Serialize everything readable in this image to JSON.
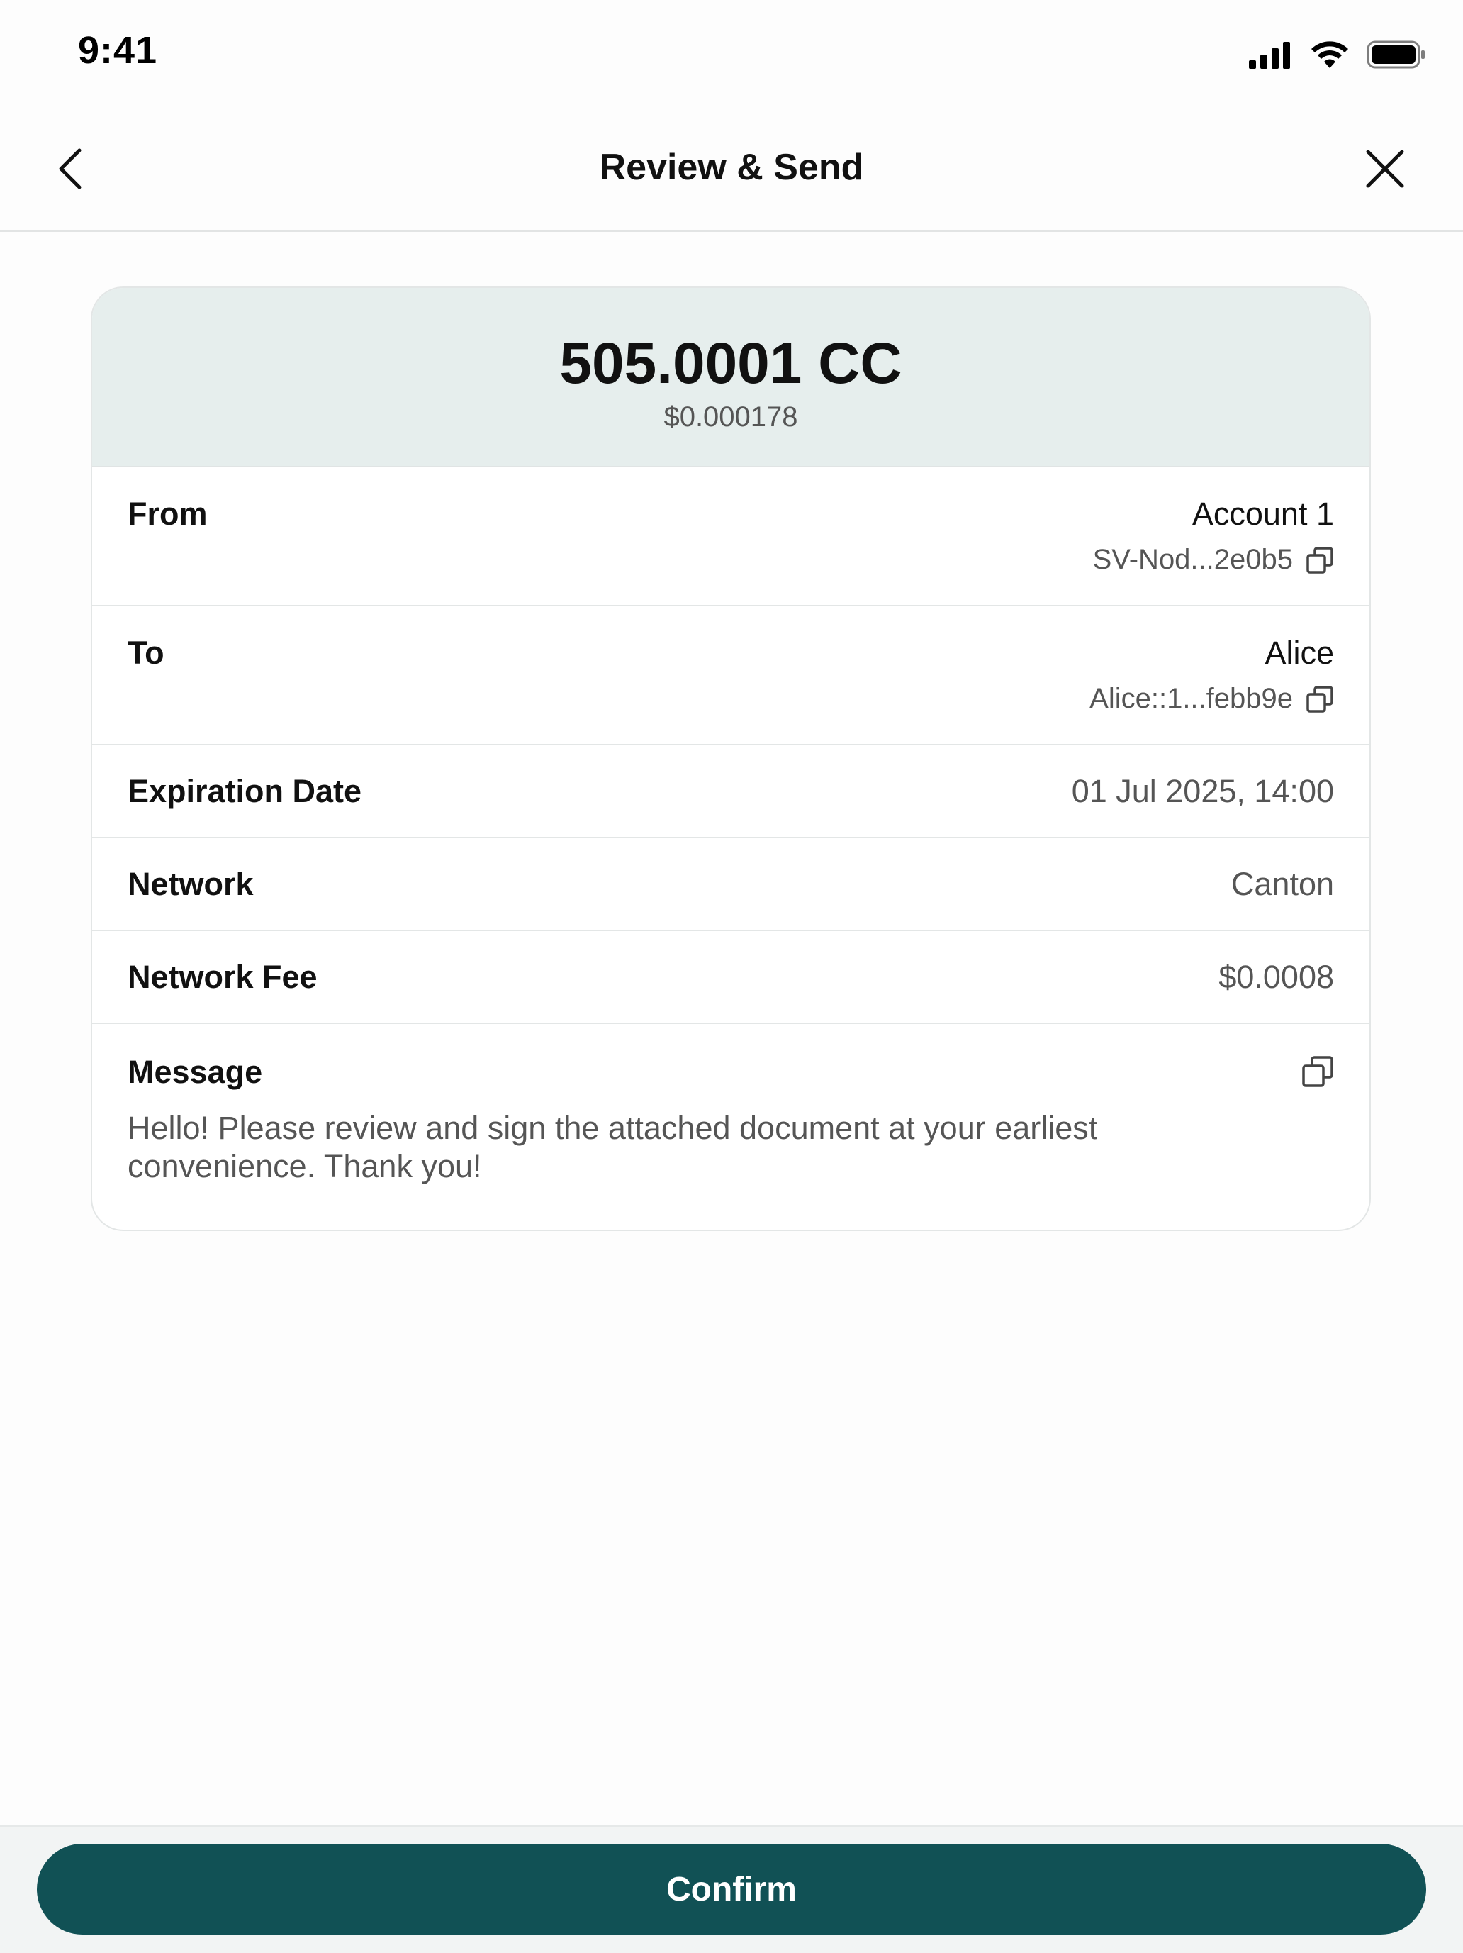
{
  "status_bar": {
    "time": "9:41"
  },
  "nav": {
    "title": "Review & Send"
  },
  "amount": {
    "value": "505.0001 CC",
    "fiat": "$0.000178"
  },
  "from": {
    "label": "From",
    "name": "Account 1",
    "id": "SV-Nod...2e0b5"
  },
  "to": {
    "label": "To",
    "name": "Alice",
    "id": "Alice::1...febb9e"
  },
  "expiration": {
    "label": "Expiration Date",
    "value": "01 Jul 2025, 14:00"
  },
  "network": {
    "label": "Network",
    "value": "Canton"
  },
  "fee": {
    "label": "Network Fee",
    "value": "$0.0008"
  },
  "message": {
    "label": "Message",
    "text": "Hello! Please review and sign the attached document at your earliest convenience. Thank you!"
  },
  "footer": {
    "confirm_label": "Confirm"
  },
  "colors": {
    "primary": "#115155",
    "header_bg": "#e6eeed"
  },
  "icons": [
    "back-chevron-icon",
    "close-icon",
    "copy-icon",
    "signal-icon",
    "wifi-icon",
    "battery-icon"
  ]
}
